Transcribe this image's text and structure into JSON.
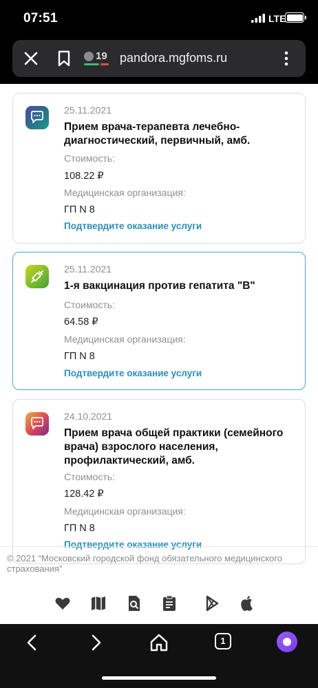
{
  "status_bar": {
    "time": "07:51",
    "network": "LTE"
  },
  "browser": {
    "tab_badge_count": "19",
    "domain": "pandora.mgfoms.ru"
  },
  "cards": [
    {
      "date": "25.11.2021",
      "title": "Прием врача-терапевта лечебно-диагностический, первичный, амб.",
      "cost_label": "Стоимость:",
      "cost_value": "108.22 ₽",
      "org_label": "Медицинская организация:",
      "org_value": "ГП N 8",
      "action": "Подтвердите оказание услуги",
      "icon": "chat-icon"
    },
    {
      "date": "25.11.2021",
      "title": "1-я вакцинация против гепатита \"В\"",
      "cost_label": "Стоимость:",
      "cost_value": "64.58 ₽",
      "org_label": "Медицинская организация:",
      "org_value": "ГП N 8",
      "action": "Подтвердите оказание услуги",
      "icon": "syringe-icon"
    },
    {
      "date": "24.10.2021",
      "title": "Прием врача общей практики (семейного врача) взрослого населения, профилактический, амб.",
      "cost_label": "Стоимость:",
      "cost_value": "128.42 ₽",
      "org_label": "Медицинская организация:",
      "org_value": "ГП N 8",
      "action": "Подтвердите оказание услуги",
      "icon": "chat-icon"
    }
  ],
  "footer": {
    "copyright": "© 2021 “Московский городской фонд обязательного медицинского страхования”",
    "icons": [
      "heart-icon",
      "map-icon",
      "document-search-icon",
      "clipboard-icon",
      "google-play-icon",
      "apple-icon"
    ]
  },
  "bottom_nav": {
    "tabs_count": "1"
  },
  "colors": {
    "link": "#2a8fc0",
    "active_border": "#4aa8c4"
  }
}
